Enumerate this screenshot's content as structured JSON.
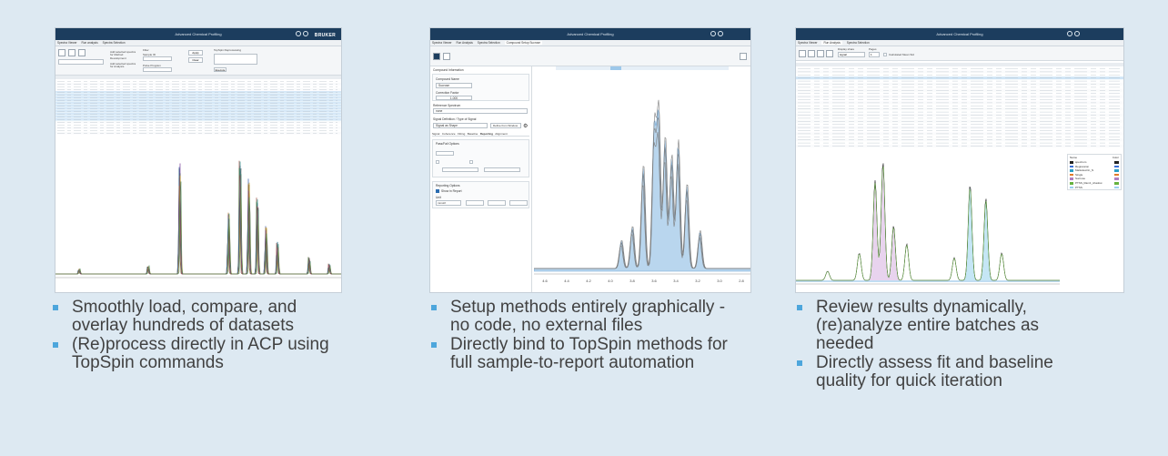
{
  "panels": [
    {
      "app_title": "Advanced Chemical Profiling",
      "logo": "BRUKER",
      "tabs": [
        "Spectra Viewer",
        "Run analysis",
        "Spectra Selection"
      ],
      "toolbar": {
        "filter_label": "Filter",
        "add_method_label": "Add selected spectra for Method Development",
        "add_analysis_label": "Add selected spectra for Analysis",
        "sample_id_label": "Sample ID",
        "pulprog_label": "Pulse Program",
        "apply_label": "Apply",
        "clear_label": "Clear",
        "topspin_label": "TopSpin Reprocessing",
        "execute_label": "Execute"
      },
      "bullets": [
        "Smoothly load, compare, and overlay hundreds of datasets",
        "(Re)process directly in ACP using TopSpin commands"
      ]
    },
    {
      "app_title": "Advanced Chemical Profiling",
      "tabs": [
        "Spectra Viewer",
        "Run Analysis",
        "Spectra Selection",
        "Compound Setup Sucrose"
      ],
      "form": {
        "compound_info": "Compound Information",
        "compound_name_label": "Compound Name",
        "compound_name": "Sucrose",
        "correction_factor_label": "Correction Factor",
        "correction_factor": "1.000",
        "reference_spectrum_label": "Reference Spectrum",
        "reference_spectrum": "none",
        "signal_def_label": "Signal Definition / Type of Signal",
        "signal_type": "Signal as Shape",
        "define_window_label": "Define from Window",
        "subtabs": [
          "Signal",
          "Coherence",
          "Fitting",
          "Baseline",
          "Reporting",
          "Alignment"
        ],
        "pass_fail_label": "Pass/Fail Options",
        "reporting_options_label": "Reporting Options",
        "show_in_report_label": "Show in Report",
        "unit_label": "Unit",
        "unit_value": "mmol/l"
      },
      "axis_ticks": [
        "4.6",
        "4.4",
        "4.2",
        "4.0",
        "3.8",
        "3.6",
        "3.4",
        "3.2",
        "3.0",
        "2.8"
      ],
      "bullets": [
        "Setup methods entirely graphically - no code, no external files",
        "Directly bind to TopSpin methods for full sample-to-report automation"
      ]
    },
    {
      "app_title": "Advanced Chemical Profiling",
      "tabs": [
        "Spectra Viewer",
        "Run Analysis",
        "Spectra Selection"
      ],
      "toolbar": {
        "display_label": "Display share",
        "display_value": "signal",
        "pages_label": "Pages",
        "pages_value": "1",
        "calc_label": "Calculated Mean Std"
      },
      "legend": {
        "name_label": "Name",
        "color_label": "Color",
        "items": [
          {
            "name": "spectrum",
            "color": "#222222"
          },
          {
            "name": "Regression",
            "color": "#3b6fd6"
          },
          {
            "name": "Maltodextrin_N",
            "color": "#2aa0c8"
          },
          {
            "name": "Single",
            "color": "#e07b2a"
          },
          {
            "name": "Sucrose",
            "color": "#b07fc0"
          },
          {
            "name": "PTSS_Ram1_shadow",
            "color": "#66b23e"
          },
          {
            "name": "PTSS",
            "color": "#9bd0ef"
          }
        ]
      },
      "bullets": [
        "Review results dynamically, (re)analyze entire batches as needed",
        "Directly assess fit and baseline quality for quick iteration"
      ]
    }
  ]
}
